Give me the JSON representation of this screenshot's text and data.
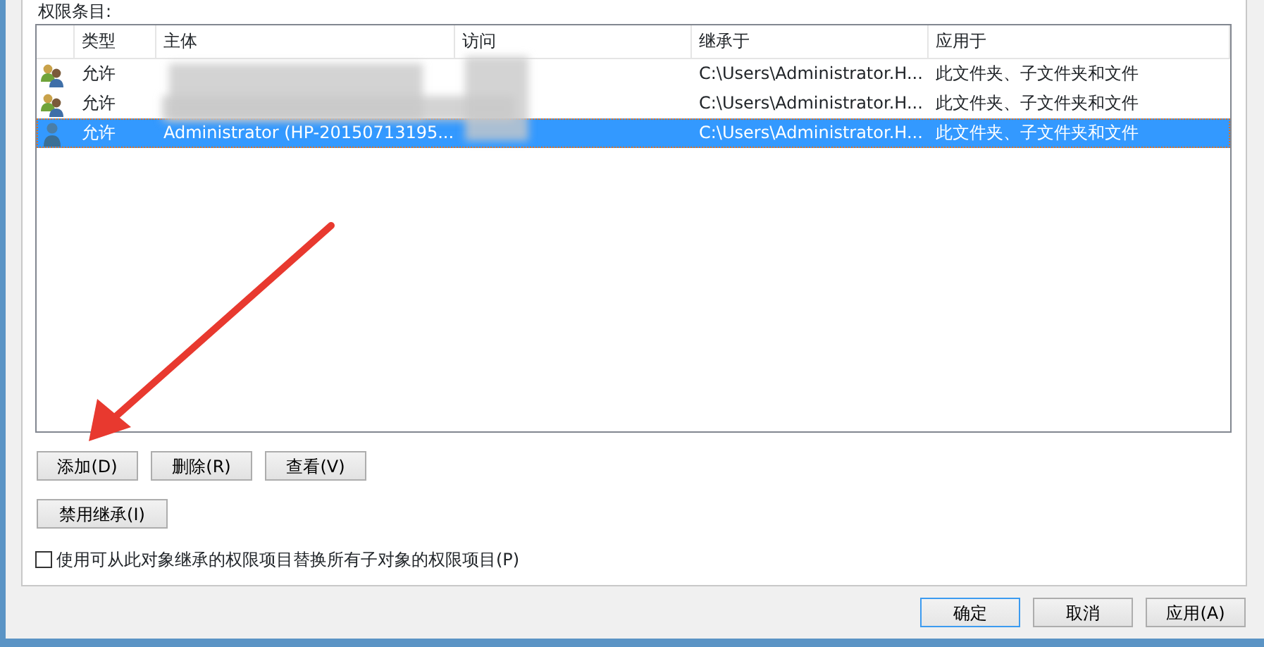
{
  "section_label": "权限条目:",
  "table": {
    "columns": [
      "类型",
      "主体",
      "访问",
      "继承于",
      "应用于"
    ],
    "rows": [
      {
        "kind": "group",
        "type": "允许",
        "principal": "",
        "inherited_from": "C:\\Users\\Administrator.H...",
        "applies_to": "此文件夹、子文件夹和文件",
        "selected": false
      },
      {
        "kind": "group",
        "type": "允许",
        "principal": "",
        "inherited_from": "C:\\Users\\Administrator.H...",
        "applies_to": "此文件夹、子文件夹和文件",
        "selected": false
      },
      {
        "kind": "user",
        "type": "允许",
        "principal": "Administrator (HP-20150713195...",
        "inherited_from": "C:\\Users\\Administrator.H...",
        "applies_to": "此文件夹、子文件夹和文件",
        "selected": true
      }
    ]
  },
  "entry_buttons": [
    {
      "label": "添加(D)"
    },
    {
      "label": "删除(R)"
    },
    {
      "label": "查看(V)"
    }
  ],
  "inherit_button": {
    "label": "禁用继承(I)"
  },
  "replace_checkbox": {
    "label": "使用可从此对象继承的权限项目替换所有子对象的权限项目(P)",
    "checked": false
  },
  "dialog_buttons": [
    {
      "label": "确定",
      "default": true
    },
    {
      "label": "取消",
      "default": false
    },
    {
      "label": "应用(A)",
      "default": false
    }
  ]
}
